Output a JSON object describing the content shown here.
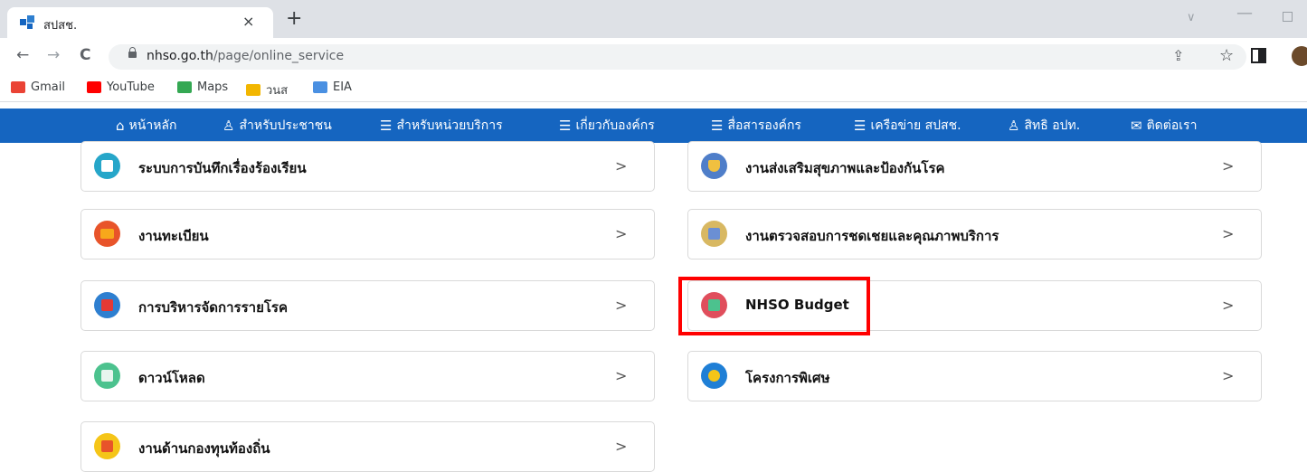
{
  "browser": {
    "tab": {
      "title": "สปสช.",
      "close": "×",
      "new_tab": "+"
    },
    "window": {
      "chevron": "∨",
      "minimize": "—"
    },
    "nav": {
      "back": "←",
      "forward": "→",
      "reload": "C"
    },
    "address": {
      "host": "nhso.go.th",
      "path": "/page/online_service"
    },
    "share_icon": "⇪",
    "star_icon": "☆",
    "bookmarks": [
      {
        "label": "Gmail",
        "icon": "gmail-icon",
        "color": "#ea4335"
      },
      {
        "label": "YouTube",
        "icon": "youtube-icon",
        "color": "#ff0000"
      },
      {
        "label": "Maps",
        "icon": "maps-icon",
        "color": "#34a853"
      },
      {
        "label": "วนส",
        "icon": "wns-icon",
        "color": "#f2b600"
      },
      {
        "label": "EIA",
        "icon": "eia-icon",
        "color": "#4a90e2"
      }
    ]
  },
  "site_nav": {
    "background": "#1565c0",
    "items": [
      {
        "icon": "⌂",
        "label": "หน้าหลัก"
      },
      {
        "icon": "♙",
        "label": "สำหรับประชาชน"
      },
      {
        "icon": "☰",
        "label": "สำหรับหน่วยบริการ"
      },
      {
        "icon": "☰",
        "label": "เกี่ยวกับองค์กร"
      },
      {
        "icon": "☰",
        "label": "สื่อสารองค์กร"
      },
      {
        "icon": "☰",
        "label": "เครือข่าย สปสช."
      },
      {
        "icon": "♙",
        "label": "สิทธิ อปท."
      },
      {
        "icon": "✉",
        "label": "ติดต่อเรา"
      }
    ]
  },
  "services": [
    {
      "label": "ระบบการบันทึกเรื่องร้องเรียน",
      "icon": "complaint-icon",
      "color": "#26a6c9",
      "chevron": ">"
    },
    {
      "label": "งานส่งเสริมสุขภาพและป้องกันโรค",
      "icon": "shield-icon",
      "color": "#4f7ec9",
      "chevron": ">"
    },
    {
      "label": "งานทะเบียน",
      "icon": "folder-icon",
      "color": "#e8542a",
      "chevron": ">"
    },
    {
      "label": "งานตรวจสอบการชดเชยและคุณภาพบริการ",
      "icon": "audit-icon",
      "color": "#d8b862",
      "chevron": ">"
    },
    {
      "label": "การบริหารจัดการรายโรค",
      "icon": "medical-kit-icon",
      "color": "#2e7fd0",
      "chevron": ">"
    },
    {
      "label": "NHSO Budget",
      "icon": "budget-chart-icon",
      "color": "#e04e5c",
      "chevron": ">"
    },
    {
      "label": "ดาวน์โหลด",
      "icon": "download-icon",
      "color": "#4cc28e",
      "chevron": ">"
    },
    {
      "label": "โครงการพิเศษ",
      "icon": "star-icon",
      "color": "#1f7fd6",
      "chevron": ">"
    },
    {
      "label": "งานด้านกองทุนท้องถิ่น",
      "icon": "briefcase-icon",
      "color": "#f5c518",
      "chevron": ">"
    }
  ],
  "highlight_color": "#ff0000"
}
